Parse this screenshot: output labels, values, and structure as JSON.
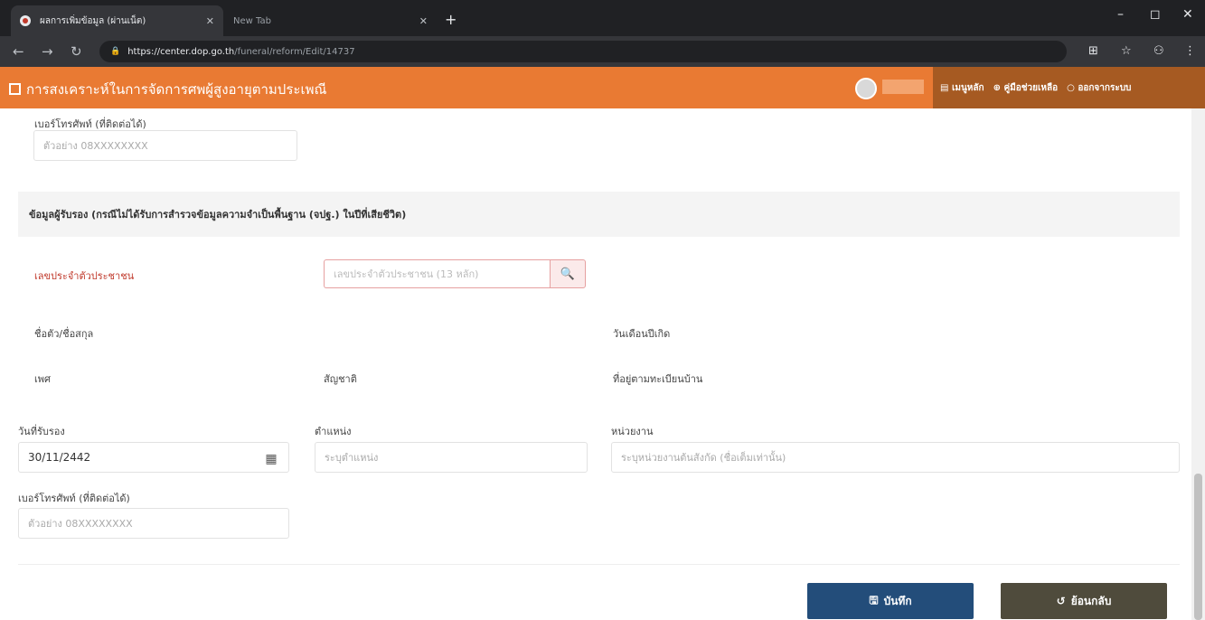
{
  "browser": {
    "active_tab_title": "ผลการเพิ่มข้อมูล (ผ่านเน็ต)",
    "inactive_tab_title": "New Tab",
    "url_host": "https://center.dop.go.th",
    "url_path": "/funeral/reform/Edit/14737"
  },
  "app": {
    "title": "การสงเคราะห์ในการจัดการศพผู้สูงอายุตามประเพณี",
    "menu": [
      "เมนูหลัก",
      "คู่มือช่วยเหลือ",
      "ออกจากระบบ"
    ]
  },
  "top_phone": {
    "label": "เบอร์โทรศัพท์ (ที่ติดต่อได้)",
    "placeholder": "ตัวอย่าง 08XXXXXXXX"
  },
  "certifier": {
    "section_title": "ข้อมูลผู้รับรอง (กรณีไม่ได้รับการสำรวจข้อมูลความจำเป็นพื้นฐาน (จปฐ.) ในปีที่เสียชีวิต)",
    "id_label": "เลขประจำตัวประชาชน",
    "id_placeholder": "เลขประจำตัวประชาชน (13 หลัก)",
    "name_label": "ชื่อตัว/ชื่อสกุล",
    "birth_label": "วันเดือนปีเกิด",
    "sex_label": "เพศ",
    "nationality_label": "สัญชาติ",
    "address_label": "ที่อยู่ตามทะเบียนบ้าน",
    "date_label": "วันที่รับรอง",
    "date_value": "30/11/2442",
    "position_label": "ตำแหน่ง",
    "position_placeholder": "ระบุตำแหน่ง",
    "agency_label": "หน่วยงาน",
    "agency_placeholder": "ระบุหน่วยงานต้นสังกัด (ชื่อเต็มเท่านั้น)",
    "phone_label": "เบอร์โทรศัพท์ (ที่ติดต่อได้)",
    "phone_placeholder": "ตัวอย่าง 08XXXXXXXX"
  },
  "buttons": {
    "save": "บันทึก",
    "back": "ย้อนกลับ"
  }
}
